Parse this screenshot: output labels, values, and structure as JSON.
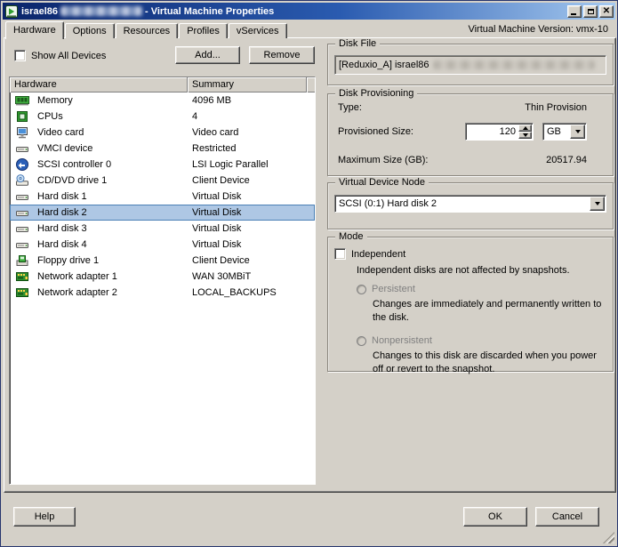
{
  "window": {
    "title_vm": "israel86",
    "title_suffix": " - Virtual Machine Properties",
    "version_label": "Virtual Machine Version: vmx-10"
  },
  "tabs": [
    {
      "label": "Hardware",
      "active": true
    },
    {
      "label": "Options",
      "active": false
    },
    {
      "label": "Resources",
      "active": false
    },
    {
      "label": "Profiles",
      "active": false
    },
    {
      "label": "vServices",
      "active": false
    }
  ],
  "left": {
    "show_all_devices_label": "Show All Devices",
    "show_all_devices_checked": false,
    "add_button": "Add...",
    "remove_button": "Remove",
    "columns": [
      "Hardware",
      "Summary"
    ],
    "rows": [
      {
        "icon": "memory",
        "label": "Memory",
        "summary": "4096 MB",
        "selected": false
      },
      {
        "icon": "cpu",
        "label": "CPUs",
        "summary": "4",
        "selected": false
      },
      {
        "icon": "video-card",
        "label": "Video card",
        "summary": "Video card",
        "selected": false
      },
      {
        "icon": "vmci",
        "label": "VMCI device",
        "summary": "Restricted",
        "selected": false
      },
      {
        "icon": "scsi-controller",
        "label": "SCSI controller 0",
        "summary": "LSI Logic Parallel",
        "selected": false
      },
      {
        "icon": "cd-dvd",
        "label": "CD/DVD drive 1",
        "summary": "Client Device",
        "selected": false
      },
      {
        "icon": "hard-disk",
        "label": "Hard disk 1",
        "summary": "Virtual Disk",
        "selected": false
      },
      {
        "icon": "hard-disk",
        "label": "Hard disk 2",
        "summary": "Virtual Disk",
        "selected": true
      },
      {
        "icon": "hard-disk",
        "label": "Hard disk 3",
        "summary": "Virtual Disk",
        "selected": false
      },
      {
        "icon": "hard-disk",
        "label": "Hard disk 4",
        "summary": "Virtual Disk",
        "selected": false
      },
      {
        "icon": "floppy",
        "label": "Floppy drive 1",
        "summary": "Client Device",
        "selected": false
      },
      {
        "icon": "network-adapter",
        "label": "Network adapter 1",
        "summary": "WAN 30MBiT",
        "selected": false
      },
      {
        "icon": "network-adapter",
        "label": "Network adapter 2",
        "summary": "LOCAL_BACKUPS",
        "selected": false
      }
    ]
  },
  "disk_file": {
    "legend": "Disk File",
    "value_visible": "[Reduxio_A] israel86"
  },
  "disk_provisioning": {
    "legend": "Disk Provisioning",
    "type_label": "Type:",
    "type_value": "Thin Provision",
    "provisioned_size_label": "Provisioned Size:",
    "provisioned_size_value": "120",
    "unit_value": "GB",
    "max_size_label": "Maximum Size (GB):",
    "max_size_value": "20517.94"
  },
  "virtual_device_node": {
    "legend": "Virtual Device Node",
    "value": "SCSI (0:1) Hard disk 2"
  },
  "mode": {
    "legend": "Mode",
    "independent_label": "Independent",
    "independent_checked": false,
    "independent_note": "Independent disks are not affected by snapshots.",
    "persistent_label": "Persistent",
    "persistent_desc": "Changes are immediately and permanently written to the disk.",
    "nonpersistent_label": "Nonpersistent",
    "nonpersistent_desc": "Changes to this disk are discarded when you power off or revert to the snapshot."
  },
  "footer": {
    "help_button": "Help",
    "ok_button": "OK",
    "cancel_button": "Cancel"
  },
  "colors": {
    "titlebar_left": "#0a246a",
    "titlebar_right": "#a6caf0",
    "dialog_bg": "#d4d0c8",
    "selection_fill": "#aec7e4",
    "selection_border": "#4b80b5"
  }
}
